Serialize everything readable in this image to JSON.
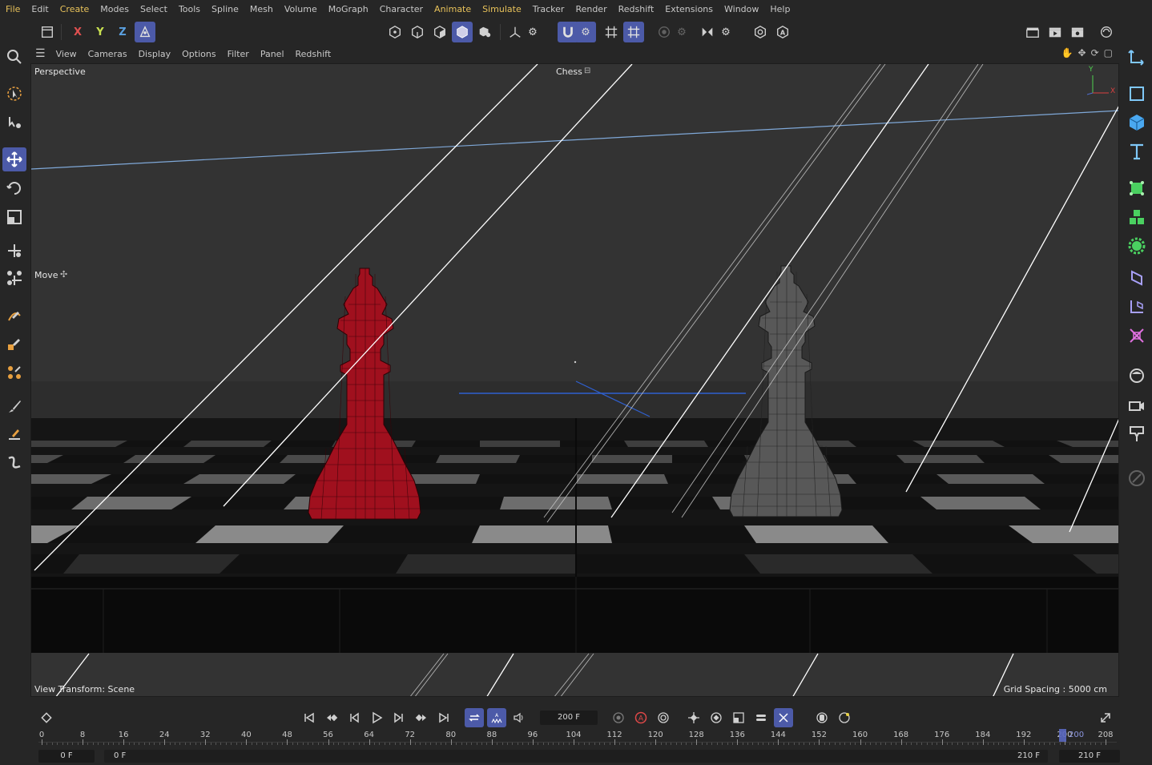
{
  "menu": [
    "File",
    "Edit",
    "Create",
    "Modes",
    "Select",
    "Tools",
    "Spline",
    "Mesh",
    "Volume",
    "MoGraph",
    "Character",
    "Animate",
    "Simulate",
    "Tracker",
    "Render",
    "Redshift",
    "Extensions",
    "Window",
    "Help"
  ],
  "menu_highlighted": [
    "File",
    "Create",
    "Animate",
    "Simulate"
  ],
  "axis_buttons": {
    "x": "X",
    "y": "Y",
    "z": "Z"
  },
  "viewport_menu": [
    "View",
    "Cameras",
    "Display",
    "Options",
    "Filter",
    "Panel",
    "Redshift"
  ],
  "viewport": {
    "camera_label": "Perspective",
    "scene_label": "Chess",
    "tool_label": "Move",
    "view_transform": "View Transform: Scene",
    "grid_spacing": "Grid Spacing : 5000 cm",
    "axis_y": "Y",
    "axis_x": "X"
  },
  "timeline": {
    "current_frame": "200 F",
    "start_frame": "0 F",
    "preview_start": "0 F",
    "preview_end": "210 F",
    "end_frame": "210 F",
    "playhead_label": "200",
    "ticks": [
      "0",
      "8",
      "16",
      "24",
      "32",
      "40",
      "48",
      "56",
      "64",
      "72",
      "80",
      "88",
      "96",
      "104",
      "112",
      "120",
      "128",
      "136",
      "144",
      "152",
      "160",
      "168",
      "176",
      "184",
      "192",
      "200",
      "208"
    ]
  },
  "colors": {
    "accent": "#4c5aa8",
    "menu_highlight": "#e8c25a",
    "red_king": "#a0101e",
    "black_king": "#5a5a5a",
    "axis_x": "#d94040",
    "axis_y": "#4fd04f"
  }
}
